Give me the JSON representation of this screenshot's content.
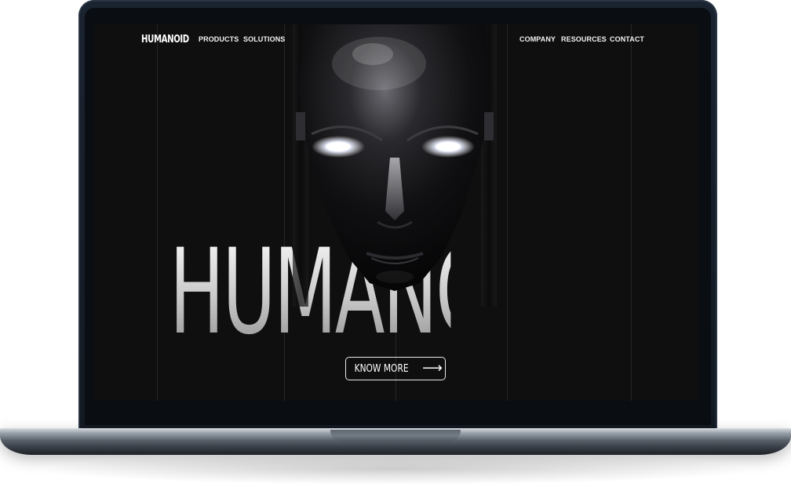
{
  "nav": {
    "logo": "HUMANOID",
    "items": [
      {
        "label": "PRODUCTS"
      },
      {
        "label": "SOLUTIONS"
      },
      {
        "label": "COMPANY"
      },
      {
        "label": "RESOURCES"
      },
      {
        "label": "CONTACT"
      }
    ]
  },
  "hero": {
    "title": "HUMANOID",
    "cta_label": "KNOW MORE",
    "cta_icon": "arrow-right-icon",
    "head_image": "chrome-humanoid-head"
  },
  "colors": {
    "screen_background": "#0f0f0f",
    "text": "#ffffff",
    "title_gradient_top": "#f2f2f2",
    "title_gradient_bottom": "#9a9a9a",
    "eye_glow": "#ffffff"
  }
}
